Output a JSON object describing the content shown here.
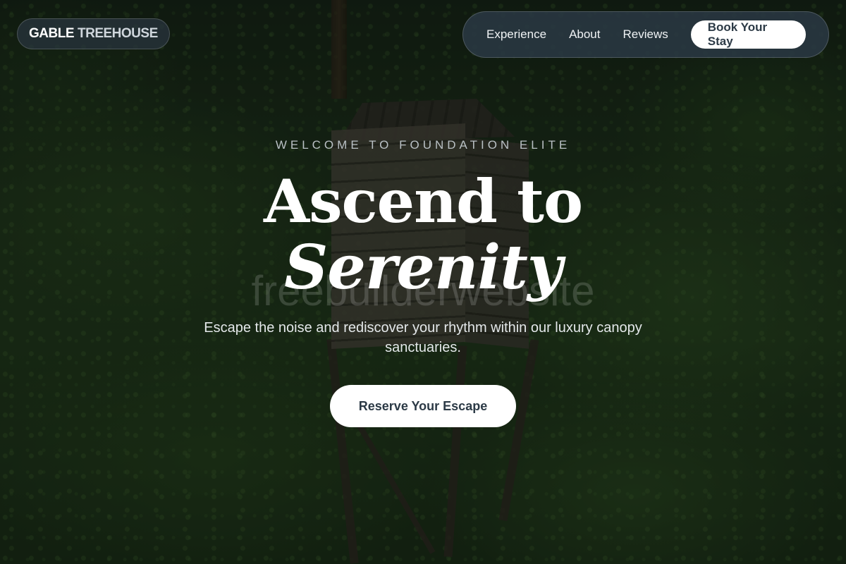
{
  "brand": {
    "primary": "GABLE",
    "secondary": "TREEHOUSE"
  },
  "nav": {
    "links": [
      "Experience",
      "About",
      "Reviews"
    ],
    "cta_label": "Book Your Stay"
  },
  "hero": {
    "eyebrow": "WELCOME TO FOUNDATION ELITE",
    "headline_line1": "Ascend to",
    "headline_line2": "Serenity",
    "watermark": "freebuilderwebsite",
    "subtitle": "Escape the noise and rediscover your rhythm within our luxury canopy sanctuaries.",
    "cta_label": "Reserve Your Escape"
  },
  "colors": {
    "button_bg": "#ffffff",
    "button_text": "#2c3a46",
    "nav_bg": "#2a3844"
  }
}
